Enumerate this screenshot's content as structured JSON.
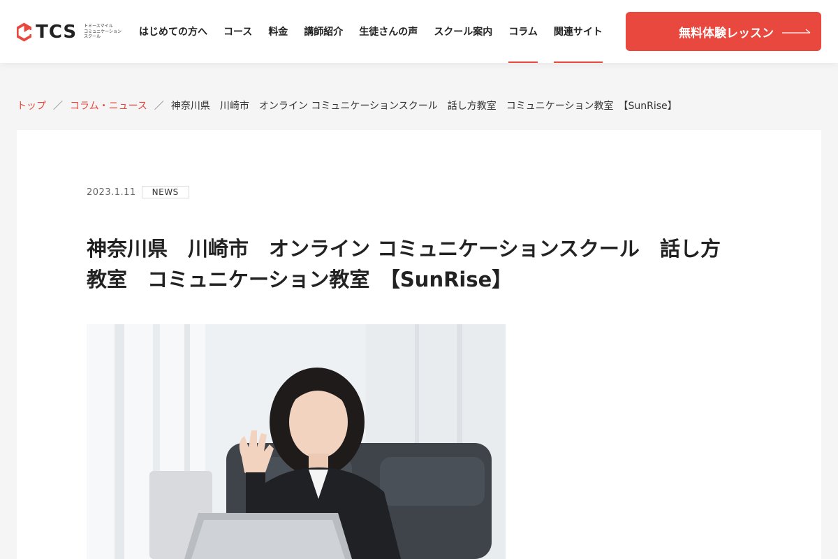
{
  "brand": {
    "logo_text": "TCS",
    "sub_lines": [
      "トミースマイル",
      "コミュニケーション",
      "スクール"
    ],
    "accent_color": "#e8483d"
  },
  "nav": {
    "items": [
      {
        "label": "はじめての方へ"
      },
      {
        "label": "コース"
      },
      {
        "label": "料金"
      },
      {
        "label": "講師紹介"
      },
      {
        "label": "生徒さんの声"
      },
      {
        "label": "スクール案内"
      },
      {
        "label": "コラム"
      },
      {
        "label": "関連サイト"
      }
    ],
    "cta_label": "無料体験レッスン"
  },
  "breadcrumb": {
    "top": "トップ",
    "category": "コラム・ニュース",
    "separator": "／",
    "current": "神奈川県　川崎市　オンライン コミュニケーションスクール　話し方教室　コミュニケーション教室　【SunRise】"
  },
  "article": {
    "date": "2023.1.11",
    "tag": "NEWS",
    "title_line1": "神奈川県　川崎市　オンライン コミュニケーションスクール　話し方",
    "title_line2": "教室　コミュニケーション教室　【SunRise】"
  }
}
